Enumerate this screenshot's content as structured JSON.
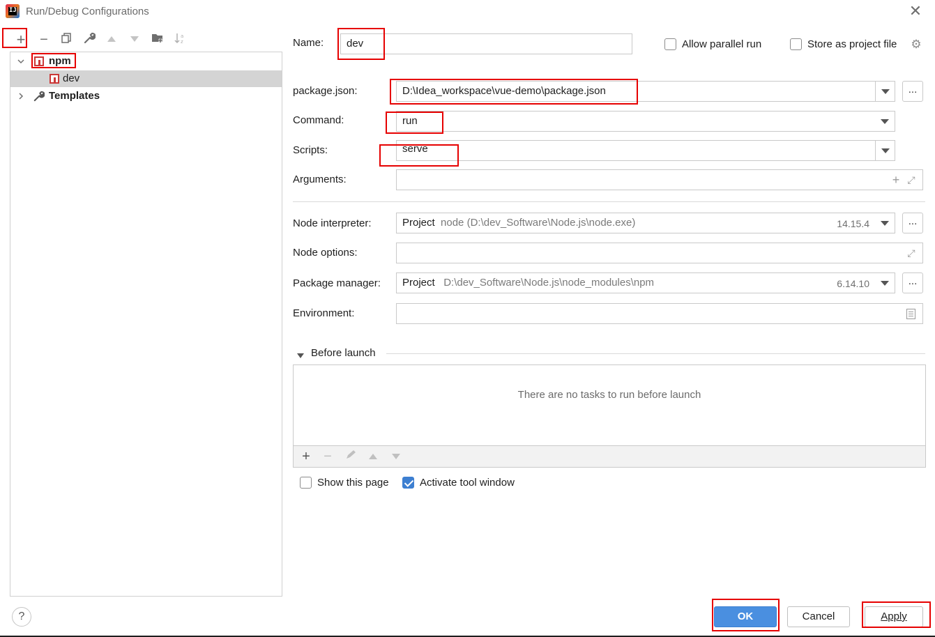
{
  "window": {
    "title": "Run/Debug Configurations"
  },
  "toolbar": {
    "add": "+",
    "remove": "−",
    "copy": "⧉",
    "edit": "🔧",
    "up": "▲",
    "down": "▼",
    "folder": "📁",
    "sort": "↓a"
  },
  "tree": {
    "items": [
      {
        "label": "npm",
        "expanded": true,
        "icon": "npm-icon"
      },
      {
        "label": "dev",
        "icon": "npm-icon",
        "selected": true
      },
      {
        "label": "Templates",
        "expanded": false,
        "icon": "wrench-icon"
      }
    ]
  },
  "form": {
    "name_label": "Name:",
    "name_value": "dev",
    "allow_parallel_label": "Allow parallel run",
    "allow_parallel_checked": false,
    "store_project_label": "Store as project file",
    "store_project_checked": false,
    "package_json_label": "package.json:",
    "package_json_value": "D:\\Idea_workspace\\vue-demo\\package.json",
    "command_label": "Command:",
    "command_value": "run",
    "scripts_label": "Scripts:",
    "scripts_value": "serve",
    "arguments_label": "Arguments:",
    "arguments_value": "",
    "node_interpreter_label": "Node interpreter:",
    "node_interpreter_kind": "Project",
    "node_interpreter_path": "node (D:\\dev_Software\\Node.js\\node.exe)",
    "node_interpreter_version": "14.15.4",
    "node_options_label": "Node options:",
    "node_options_value": "",
    "package_manager_label": "Package manager:",
    "package_manager_kind": "Project",
    "package_manager_path": "D:\\dev_Software\\Node.js\\node_modules\\npm",
    "package_manager_version": "6.14.10",
    "environment_label": "Environment:",
    "environment_value": "",
    "dots": "..."
  },
  "before_launch": {
    "title": "Before launch",
    "empty_text": "There are no tasks to run before launch",
    "show_page_label": "Show this page",
    "show_page_checked": false,
    "activate_tool_label": "Activate tool window",
    "activate_tool_checked": true
  },
  "buttons": {
    "ok": "OK",
    "cancel": "Cancel",
    "apply": "Apply",
    "help": "?"
  },
  "colors": {
    "highlight": "#e60000",
    "primary": "#4a8fe0",
    "selection": "#d4d4d4",
    "npm": "#cb3837"
  }
}
